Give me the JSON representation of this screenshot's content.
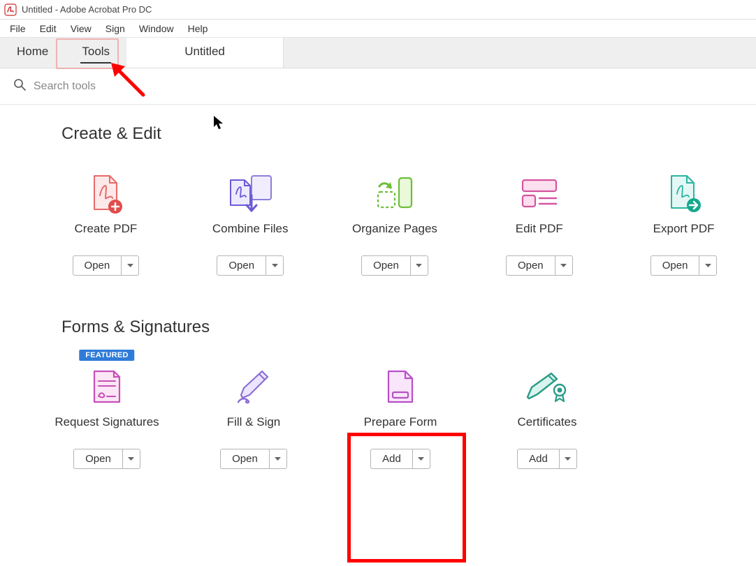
{
  "window": {
    "title": "Untitled - Adobe Acrobat Pro DC"
  },
  "menu": {
    "items": [
      "File",
      "Edit",
      "View",
      "Sign",
      "Window",
      "Help"
    ]
  },
  "tabs": {
    "home": "Home",
    "tools": "Tools",
    "document": "Untitled"
  },
  "search": {
    "placeholder": "Search tools"
  },
  "sections": {
    "create_edit": {
      "title": "Create & Edit",
      "tools": [
        {
          "label": "Create PDF",
          "action": "Open"
        },
        {
          "label": "Combine Files",
          "action": "Open"
        },
        {
          "label": "Organize Pages",
          "action": "Open"
        },
        {
          "label": "Edit PDF",
          "action": "Open"
        },
        {
          "label": "Export PDF",
          "action": "Open"
        }
      ]
    },
    "forms_signatures": {
      "title": "Forms & Signatures",
      "tools": [
        {
          "label": "Request Signatures",
          "action": "Open",
          "featured": "FEATURED"
        },
        {
          "label": "Fill & Sign",
          "action": "Open"
        },
        {
          "label": "Prepare Form",
          "action": "Add"
        },
        {
          "label": "Certificates",
          "action": "Add"
        }
      ]
    }
  },
  "colors": {
    "highlight_red": "#ff0000",
    "featured_blue": "#2f7bd9"
  }
}
